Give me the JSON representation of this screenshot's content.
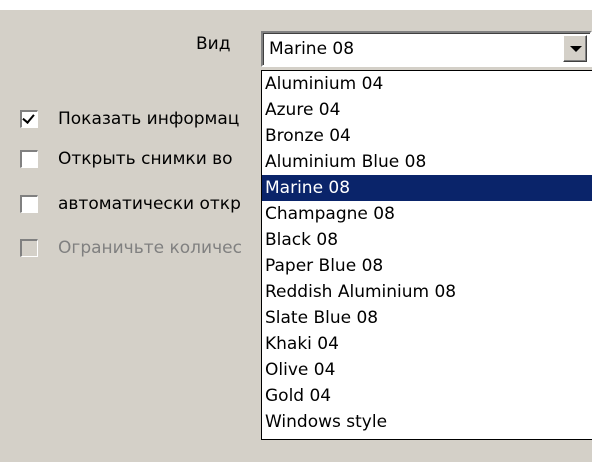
{
  "view": {
    "label": "Вид",
    "selected": "Marine 08",
    "options": [
      "Aluminium 04",
      "Azure 04",
      "Bronze 04",
      "Aluminium Blue 08",
      "Marine 08",
      "Champagne 08",
      "Black 08",
      "Paper Blue 08",
      "Reddish Aluminium 08",
      "Slate Blue 08",
      "Khaki 04",
      "Olive 04",
      "Gold 04",
      "Windows style"
    ]
  },
  "checkboxes": [
    {
      "label": "Показать информац",
      "checked": true,
      "enabled": true
    },
    {
      "label": "Открыть снимки во",
      "checked": false,
      "enabled": true
    },
    {
      "label": "автоматически откр",
      "checked": false,
      "enabled": true
    },
    {
      "label": "Ограничьте количес",
      "checked": false,
      "enabled": false
    }
  ],
  "colors": {
    "dialog_bg": "#d4d0c8",
    "selection_bg": "#0a246a",
    "selection_text": "#ffffff",
    "disabled_text": "#808080"
  },
  "icons": {
    "dropdown_button": "chevron-down-icon",
    "checkbox_check": "checkmark-icon"
  }
}
